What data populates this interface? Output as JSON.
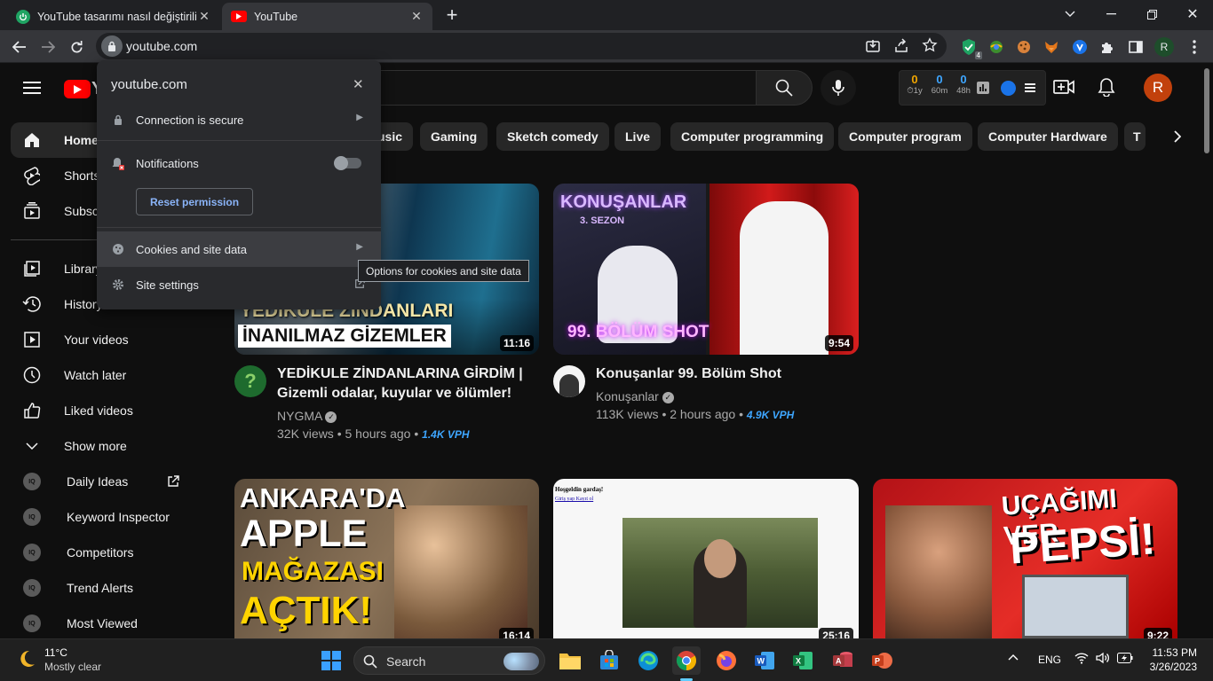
{
  "browser": {
    "tabs": [
      {
        "title": "YouTube tasarımı nasıl değiştirilir"
      },
      {
        "title": "YouTube"
      }
    ],
    "url": "youtube.com",
    "profile_initial": "R",
    "extension_badge": "4"
  },
  "site_popup": {
    "domain": "youtube.com",
    "connection_label": "Connection is secure",
    "notifications_label": "Notifications",
    "reset_permission_label": "Reset permission",
    "cookies_label": "Cookies and site data",
    "site_settings_label": "Site settings",
    "tooltip": "Options for cookies and site data"
  },
  "youtube": {
    "logo_text": "Y",
    "vph_widget": [
      {
        "value": "0",
        "label": "1y",
        "color": "#f0a500"
      },
      {
        "value": "0",
        "label": "60m",
        "color": "#3ea6ff"
      },
      {
        "value": "0",
        "label": "48h",
        "color": "#3ea6ff"
      }
    ],
    "avatar_initial": "R",
    "chips": [
      "usic",
      "Gaming",
      "Sketch comedy",
      "Live",
      "Computer programming",
      "Computer program",
      "Computer Hardware",
      "T"
    ],
    "sidebar": {
      "main": [
        "Home",
        "Shorts",
        "Subsc"
      ],
      "library": [
        "Library",
        "History",
        "Your videos",
        "Watch later",
        "Liked videos",
        "Show more"
      ],
      "vidiq": [
        "Daily Ideas",
        "Keyword Inspector",
        "Competitors",
        "Trend Alerts",
        "Most Viewed"
      ]
    },
    "videos": [
      {
        "title": "YEDİKULE ZİNDANLARINA GİRDİM | Gizemli odalar, kuyular ve ölümler!",
        "channel": "NYGMA",
        "views": "32K views",
        "age": "5 hours ago",
        "vph": "1.4K VPH",
        "duration": "11:16",
        "thumb_text_1": "YEDİKULE ZİNDANLARI",
        "thumb_text_2": "İNANILMAZ GİZEMLER"
      },
      {
        "title": "Konuşanlar 99. Bölüm Shot",
        "channel": "Konuşanlar",
        "views": "113K views",
        "age": "2 hours ago",
        "vph": "4.9K VPH",
        "duration": "9:54",
        "thumb_text_1": "KONUŞANLAR",
        "thumb_text_2": "3. SEZON",
        "thumb_text_3": "99. BÖLÜM SHOT"
      },
      {
        "duration": "16:14",
        "thumb_text_1": "ANKARA'DA",
        "thumb_text_2": "APPLE",
        "thumb_text_3": "MAĞAZASI",
        "thumb_text_4": "AÇTIK!"
      },
      {
        "duration": "25:16",
        "thumb_text_1": "Hoşgeldin gardaş!",
        "thumb_text_2": "Giriş yap Kayıt ol"
      },
      {
        "duration": "9:22",
        "thumb_text_1": "UÇAĞIMI VER",
        "thumb_text_2": "PEPSİ!"
      }
    ]
  },
  "taskbar": {
    "weather_temp": "11°C",
    "weather_desc": "Mostly clear",
    "search_label": "Search",
    "language": "ENG",
    "time": "11:53 PM",
    "date": "3/26/2023"
  }
}
